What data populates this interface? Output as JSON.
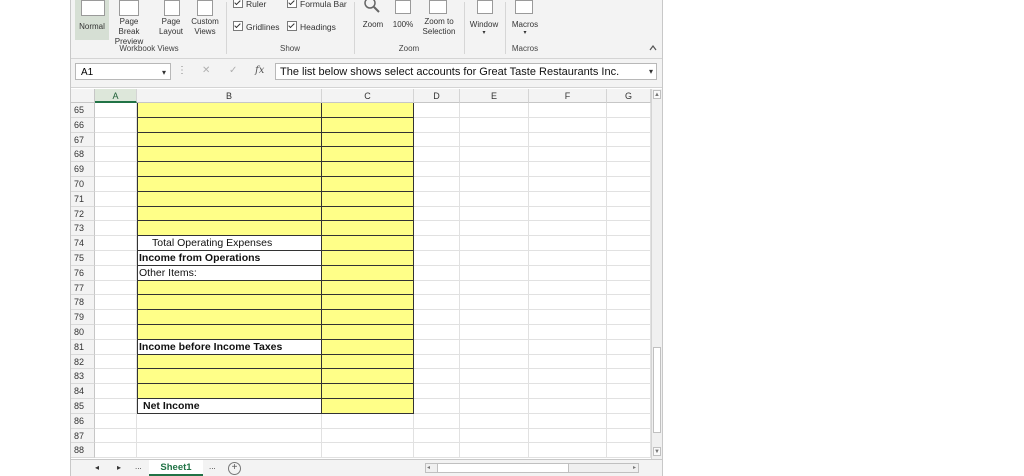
{
  "ribbon": {
    "workbook_views": {
      "label": "Workbook Views",
      "buttons": [
        {
          "line1": "Normal",
          "line2": ""
        },
        {
          "line1": "Page Break",
          "line2": "Preview"
        },
        {
          "line1": "Page",
          "line2": "Layout"
        },
        {
          "line1": "Custom",
          "line2": "Views"
        }
      ]
    },
    "show": {
      "label": "Show",
      "ruler": "Ruler",
      "formula_bar": "Formula Bar",
      "gridlines": "Gridlines",
      "headings": "Headings"
    },
    "zoom": {
      "label": "Zoom",
      "zoom": "Zoom",
      "zoom_100": "100%",
      "zoom_sel_1": "Zoom to",
      "zoom_sel_2": "Selection"
    },
    "window": {
      "label": "Window",
      "arrow": "▾"
    },
    "macros": {
      "label": "Macros",
      "group_label": "Macros",
      "arrow": "▾"
    },
    "collapse_icon": "collapse-ribbon-icon"
  },
  "formula_bar": {
    "name_box": "A1",
    "cancel": "✕",
    "enter": "✓",
    "fx": "fx",
    "content": "The list below shows select accounts for Great Taste Restaurants Inc."
  },
  "columns": [
    "A",
    "B",
    "C",
    "D",
    "E",
    "F",
    "G"
  ],
  "rows": [
    {
      "num": "65",
      "b": "",
      "style": "y"
    },
    {
      "num": "66",
      "b": "",
      "style": "y"
    },
    {
      "num": "67",
      "b": "",
      "style": "y"
    },
    {
      "num": "68",
      "b": "",
      "style": "y"
    },
    {
      "num": "69",
      "b": "",
      "style": "y"
    },
    {
      "num": "70",
      "b": "",
      "style": "y"
    },
    {
      "num": "71",
      "b": "",
      "style": "y"
    },
    {
      "num": "72",
      "b": "",
      "style": "y"
    },
    {
      "num": "73",
      "b": "",
      "style": "y"
    },
    {
      "num": "74",
      "b": "Total Operating Expenses",
      "style": "w-indent"
    },
    {
      "num": "75",
      "b": "Income from Operations",
      "style": "w-bold"
    },
    {
      "num": "76",
      "b": "Other Items:",
      "style": "w"
    },
    {
      "num": "77",
      "b": "",
      "style": "y"
    },
    {
      "num": "78",
      "b": "",
      "style": "y"
    },
    {
      "num": "79",
      "b": "",
      "style": "y"
    },
    {
      "num": "80",
      "b": "",
      "style": "y"
    },
    {
      "num": "81",
      "b": "Income before Income Taxes",
      "style": "w-bold"
    },
    {
      "num": "82",
      "b": "",
      "style": "y"
    },
    {
      "num": "83",
      "b": "",
      "style": "y"
    },
    {
      "num": "84",
      "b": "",
      "style": "y"
    },
    {
      "num": "85",
      "b": "Net Income",
      "style": "w-bold-indent"
    },
    {
      "num": "86",
      "b": "",
      "style": "none"
    },
    {
      "num": "87",
      "b": "",
      "style": "none"
    },
    {
      "num": "88",
      "b": "",
      "style": "none"
    }
  ],
  "tabs": {
    "prev": "◂",
    "next": "▸",
    "more_left": "...",
    "sheet": "Sheet1",
    "more_right": "...",
    "add": "+"
  },
  "colors": {
    "highlight": "#ffff88",
    "accent": "#217346"
  }
}
